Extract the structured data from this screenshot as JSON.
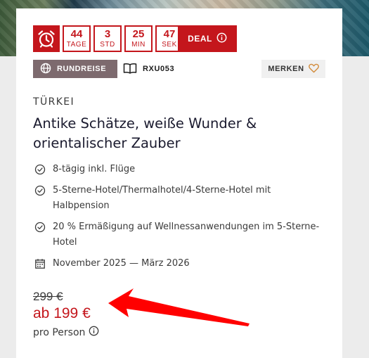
{
  "countdown": {
    "days": {
      "value": "44",
      "unit": "TAGE"
    },
    "hours": {
      "value": "3",
      "unit": "STD"
    },
    "minutes": {
      "value": "25",
      "unit": "MIN"
    },
    "seconds": {
      "value": "47",
      "unit": "SEK"
    }
  },
  "deal": {
    "label": "DEAL"
  },
  "tags": {
    "type_label": "RUNDREISE",
    "code": "RXU053",
    "save_label": "MERKEN"
  },
  "offer": {
    "country": "TÜRKEI",
    "title": "Antike Schätze, weiße Wunder & orientalischer Zauber",
    "features": [
      "8-tägig inkl. Flüge",
      "5-Sterne-Hotel/Thermalhotel/4-Sterne-Hotel mit Halbpension",
      "20 % Ermäßigung auf Wellnessanwendungen im 5-Sterne-Hotel"
    ],
    "travel_period": "November 2025 — März 2026"
  },
  "price": {
    "old": "299 €",
    "new": "ab 199 €",
    "unit": "pro Person"
  },
  "colors": {
    "accent_red": "#c4161c",
    "type_tag": "#7d6a6e",
    "heart": "#d28a3a",
    "annotation_arrow": "#ff0000"
  },
  "icons": {
    "alarm": "alarm-clock-icon",
    "info": "info-icon",
    "globe": "globe-icon",
    "book": "book-icon",
    "heart": "heart-icon",
    "check": "check-circle-icon",
    "calendar": "calendar-icon"
  }
}
